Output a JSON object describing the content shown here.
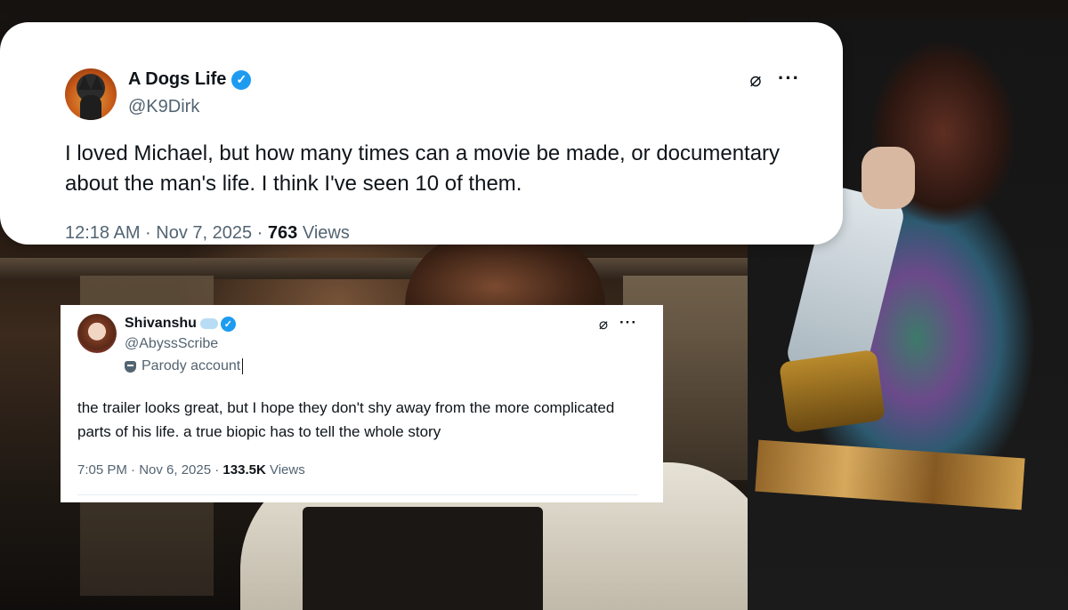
{
  "tweets": [
    {
      "display_name": "A Dogs Life",
      "handle": "@K9Dirk",
      "verified": true,
      "text": "I loved Michael, but how many times can a movie be made, or documentary about the man's life. I think I've seen 10 of them.",
      "timestamp": "12:18 AM · Nov 7, 2025 ·",
      "views_count": "763",
      "views_label": "Views",
      "icons": [
        "grok-icon",
        "more-icon",
        "verified-badge-icon"
      ]
    },
    {
      "display_name": "Shivanshu",
      "handle": "@AbyssScribe",
      "verified": true,
      "badge_label": "Parody account",
      "text": "the trailer looks great, but I hope they don't shy away from the more complicated parts of his life. a true biopic has to tell the whole story",
      "timestamp": "7:05 PM · Nov 6, 2025 ·",
      "views_count": "133.5K",
      "views_label": "Views",
      "icons": [
        "grok-icon",
        "more-icon",
        "verified-badge-icon",
        "parody-mask-icon"
      ]
    }
  ],
  "icon_glyphs": {
    "grok": "⌀",
    "more": "···",
    "verified": "✓"
  },
  "colors": {
    "verified_blue": "#1d9bf0",
    "text_primary": "#0f1419",
    "text_secondary": "#536471"
  }
}
